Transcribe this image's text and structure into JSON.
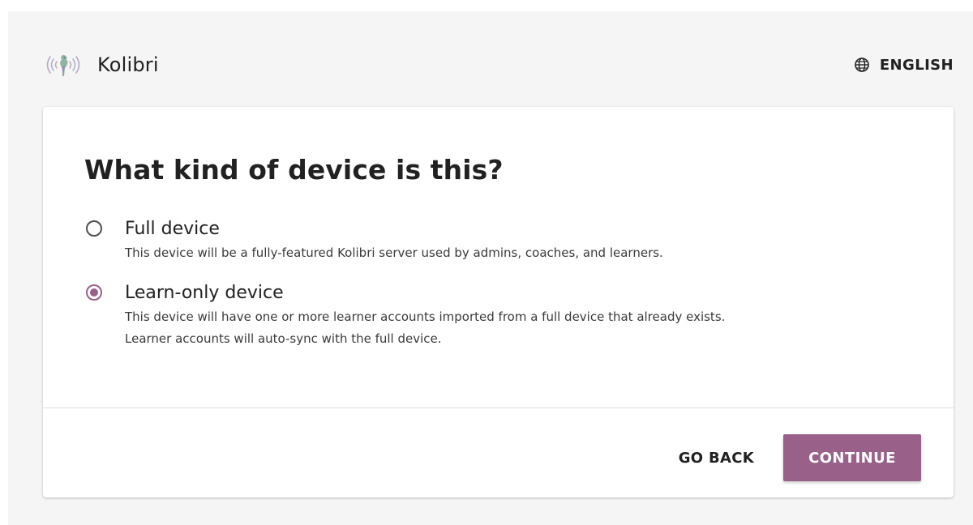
{
  "header": {
    "app_name": "Kolibri",
    "language_label": "ENGLISH",
    "language_icon": "globe-icon",
    "logo_icon": "kolibri-logo-icon"
  },
  "setup": {
    "title": "What kind of device is this?",
    "options": [
      {
        "label": "Full device",
        "description_lines": [
          "This device will be a fully-featured Kolibri server used by admins, coaches, and learners."
        ],
        "selected": false
      },
      {
        "label": "Learn-only device",
        "description_lines": [
          "This device will have one or more learner accounts imported from a full device that already exists.",
          "Learner accounts will auto-sync with the full device."
        ],
        "selected": true
      }
    ],
    "back_label": "GO BACK",
    "continue_label": "CONTINUE"
  },
  "colors": {
    "accent": "#996189",
    "background": "#f5f5f5",
    "card": "#ffffff",
    "text": "#212121"
  }
}
